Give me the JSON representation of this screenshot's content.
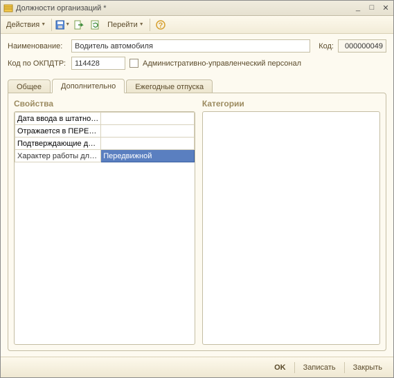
{
  "window": {
    "title": "Должности организаций *"
  },
  "toolbar": {
    "actions_label": "Действия",
    "goto_label": "Перейти"
  },
  "form": {
    "name_label": "Наименование:",
    "name_value": "Водитель автомобиля",
    "code_label": "Код:",
    "code_value": "000000049",
    "okpdtr_label": "Код по ОКПДТР:",
    "okpdtr_value": "114428",
    "admin_checkbox_label": "Административно-управленческий персонал"
  },
  "tabs": {
    "general": "Общее",
    "additional": "Дополнительно",
    "vacations": "Ежегодные отпуска"
  },
  "panels": {
    "properties_title": "Свойства",
    "categories_title": "Категории"
  },
  "properties": {
    "rows": [
      {
        "name": "Дата ввода в штатное…",
        "value": ""
      },
      {
        "name": "Отражается в ПЕРЕЧ…",
        "value": ""
      },
      {
        "name": "Подтверждающие док…",
        "value": ""
      },
      {
        "name": "Характер работы для …",
        "value": "Передвижной"
      }
    ]
  },
  "buttons": {
    "ok": "OK",
    "save": "Записать",
    "close": "Закрыть"
  }
}
